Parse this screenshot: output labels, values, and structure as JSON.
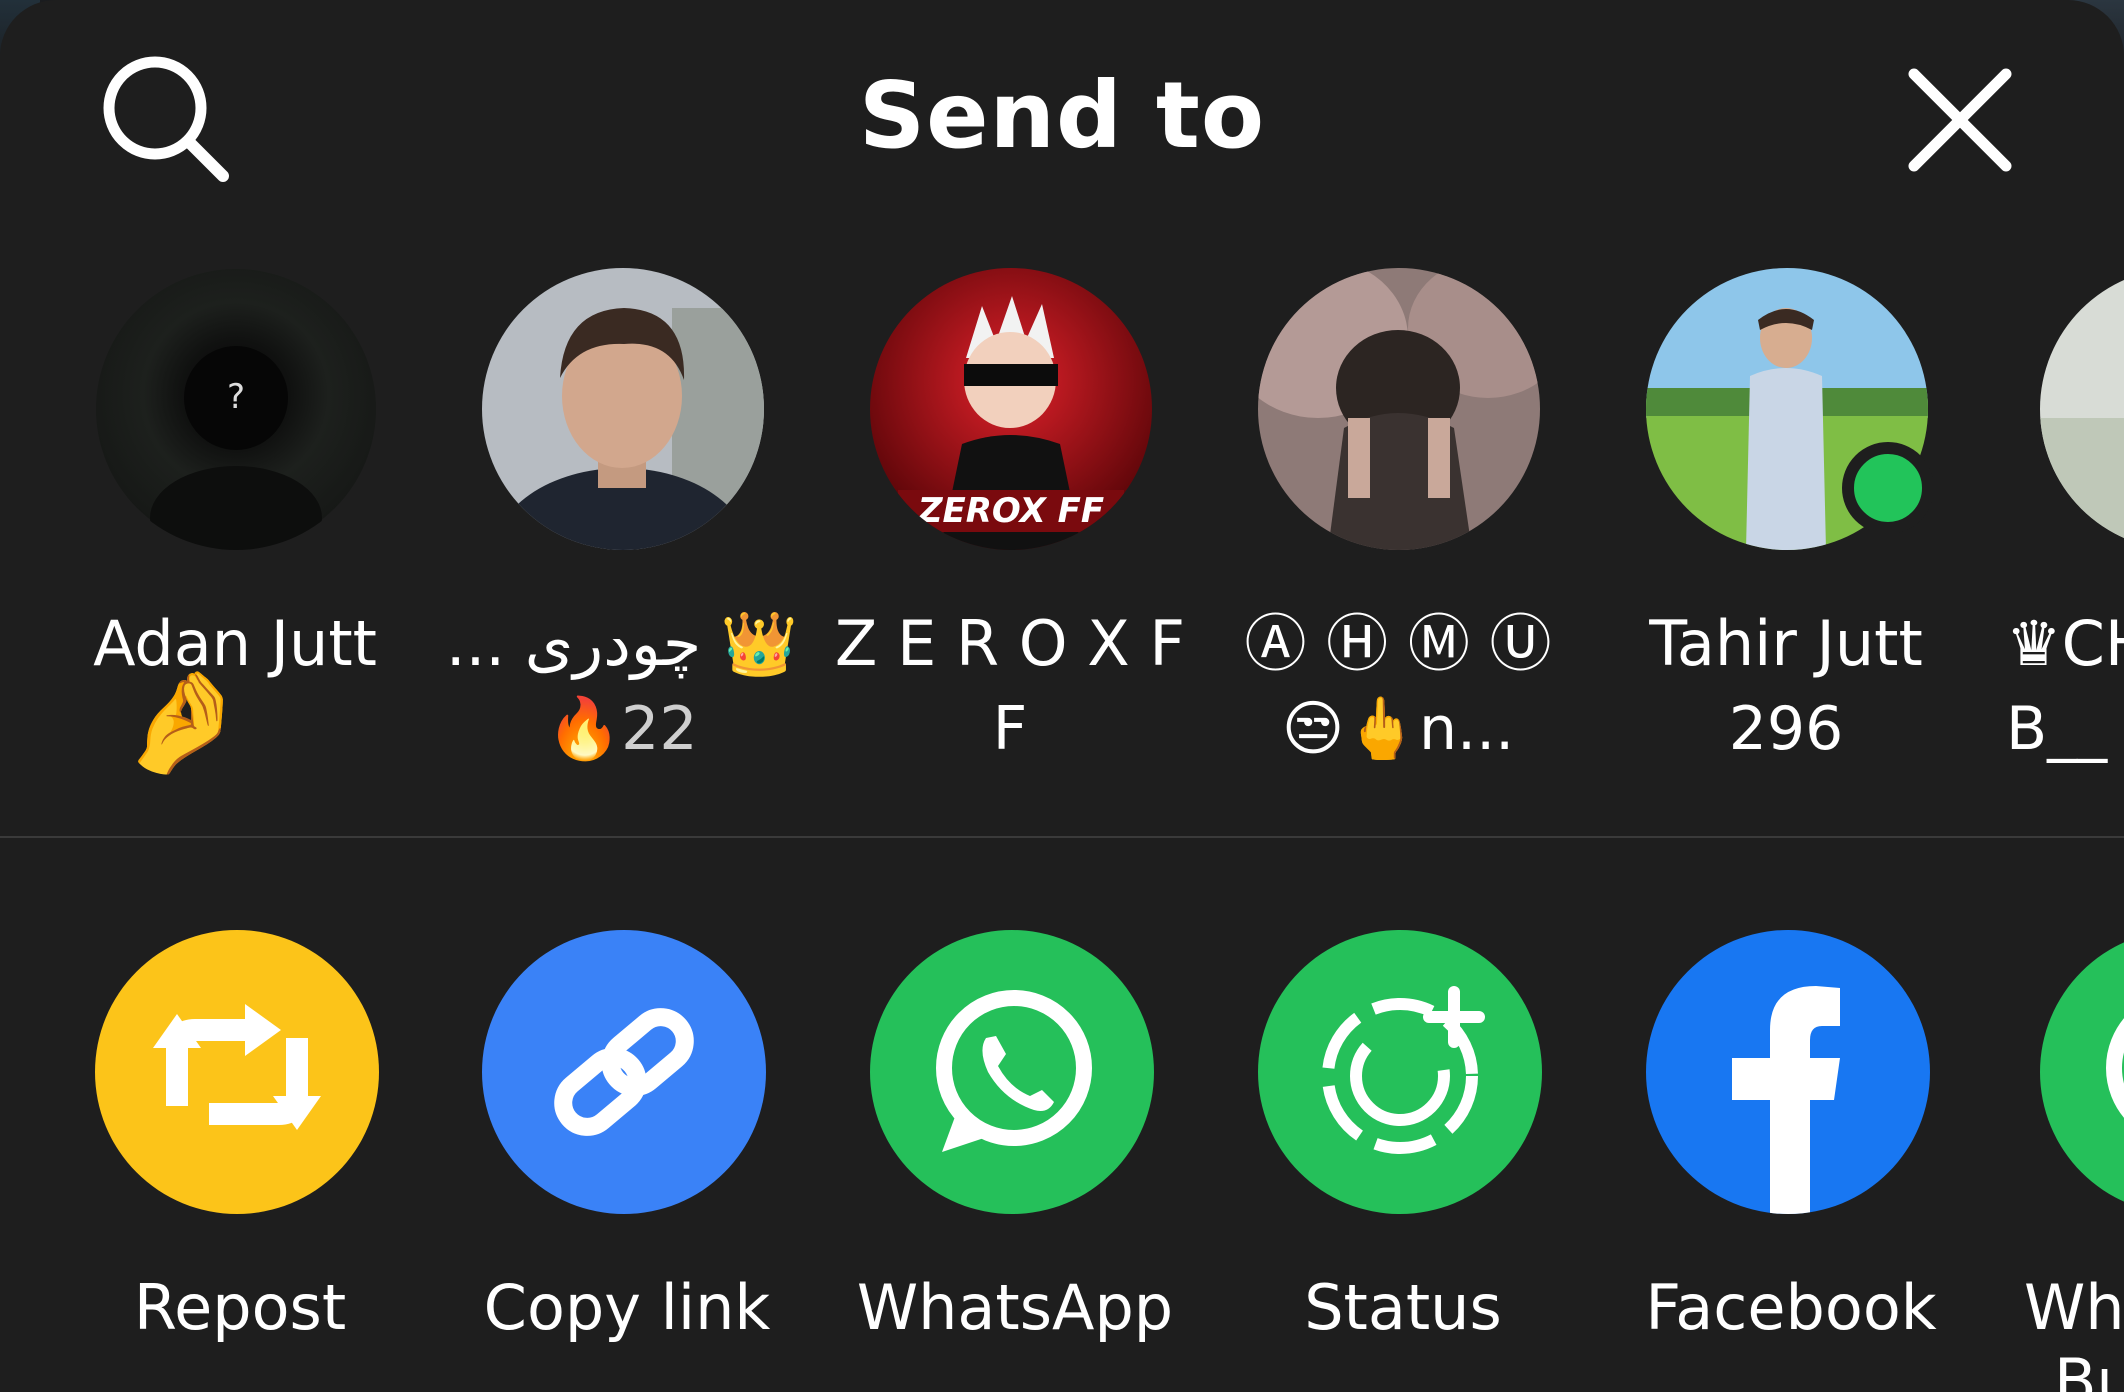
{
  "header": {
    "title": "Send to",
    "search_icon": "search-icon",
    "close_icon": "close-icon"
  },
  "contacts": [
    {
      "name": "Adan Jutt",
      "sub": "🤌"
    },
    {
      "name": "... چودری 👑",
      "sub": "🔥22"
    },
    {
      "name": "Z E R O X F",
      "sub": "F",
      "avatar_text": "ZEROX FF"
    },
    {
      "name": "Ⓐ Ⓗ Ⓜ Ⓤ",
      "sub": "😒🖕n..."
    },
    {
      "name": "Tahir Jutt",
      "sub": "296",
      "online": true
    },
    {
      "name": "♛CH",
      "sub": "B__"
    }
  ],
  "apps": [
    {
      "label": "Repost",
      "icon": "repost-icon",
      "color": "#fcc419"
    },
    {
      "label": "Copy link",
      "icon": "link-icon",
      "color": "#3a82f7"
    },
    {
      "label": "WhatsApp",
      "icon": "whatsapp-icon",
      "color": "#25c05a"
    },
    {
      "label": "Status",
      "icon": "status-icon",
      "color": "#25c05a"
    },
    {
      "label": "Facebook",
      "icon": "facebook-icon",
      "color": "#1877f2"
    },
    {
      "label": "Wh",
      "sub": "Bu",
      "icon": "whatsapp-business-icon",
      "color": "#25c05a"
    }
  ],
  "colors": {
    "background": "#1e1e1e",
    "divider": "#3a3a3a",
    "online": "#22c45a"
  }
}
